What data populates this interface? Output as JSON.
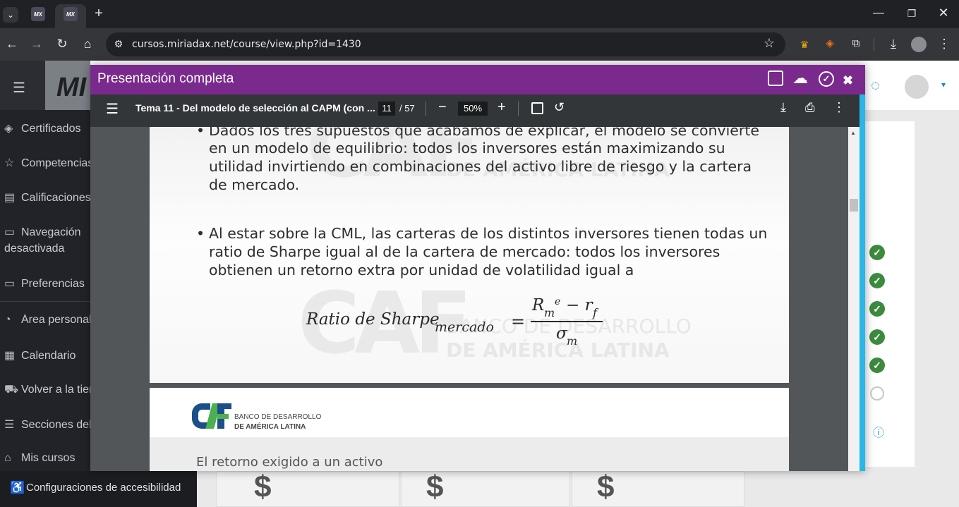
{
  "browser": {
    "tabs": [
      {
        "favicon": "MX"
      },
      {
        "favicon": "MX"
      }
    ],
    "url": "cursos.miriadax.net/course/view.php?id=1430"
  },
  "site": {
    "brand": "MI"
  },
  "sidebar": {
    "items": [
      {
        "icon": "layers-icon",
        "label": "Certificados"
      },
      {
        "icon": "star-icon",
        "label": "Competencias"
      },
      {
        "icon": "gradebook-icon",
        "label": "Calificaciones"
      },
      {
        "icon": "folder-icon",
        "label": "Navegación",
        "label2": "desactivada"
      },
      {
        "icon": "folder-icon",
        "label": "Preferencias"
      },
      {
        "icon": "dashboard-icon",
        "label": "Área personal"
      },
      {
        "icon": "calendar-icon",
        "label": "Calendario"
      },
      {
        "icon": "cart-icon",
        "label": "Volver a la tienda"
      },
      {
        "icon": "list-icon",
        "label": "Secciones del curso"
      },
      {
        "icon": "graduation-icon",
        "label": "Mis cursos"
      }
    ],
    "accessibility": "Configuraciones de accesibilidad"
  },
  "modal": {
    "title": "Presentación completa"
  },
  "pdf": {
    "document_title": "Tema 11 - Del modelo de selección al CAPM (con ...",
    "current_page": "11",
    "total_pages": "/ 57",
    "zoom": "50%"
  },
  "slide1": {
    "bullet1_line0": "Dados los tres supuestos que acabamos de explicar, el modelo se convierte",
    "bullet1_lines": [
      "en un modelo de equilibrio: todos los inversores están maximizando su",
      "utilidad invirtiendo en combinaciones del activo libre de riesgo y la cartera",
      "de mercado."
    ],
    "bullet2_lines": [
      "Al estar sobre la CML, las carteras de los distintos inversores tienen todas un",
      "ratio de Sharpe igual al de la cartera de mercado: todos los inversores",
      "obtienen un retorno extra por unidad de volatilidad igual a"
    ],
    "formula": {
      "lhs": "Ratio de Sharpe",
      "lhs_sub": "mercado",
      "equals": "=",
      "num_R": "R",
      "num_sub_m": "m",
      "num_sup_e": "e",
      "num_minus": "− r",
      "num_sub_f": "f",
      "den": "σ",
      "den_sub": "m"
    },
    "watermark_line1": "BANCO DE DESARROLLO",
    "watermark_line2": "DE AMÉRICA LATINA"
  },
  "slide2": {
    "logo_mark": "CAF",
    "logo_line1": "BANCO DE DESARROLLO",
    "logo_line2": "DE AMÉRICA LATINA",
    "heading": "El retorno exigido a un activo"
  },
  "cards": {
    "symbol": "$"
  },
  "colors": {
    "modal_header": "#7a2a8d",
    "accent_cyan": "#29b6e8",
    "check_green": "#3c8a3e",
    "caf_blue": "#1c4e8a",
    "caf_green": "#4caf50"
  }
}
